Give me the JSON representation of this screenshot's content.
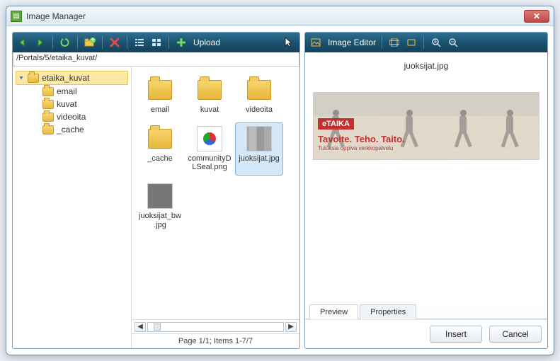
{
  "window": {
    "title": "Image Manager"
  },
  "toolbar": {
    "upload_label": "Upload",
    "editor_label": "Image Editor"
  },
  "path": "/Portals/5/etaika_kuvat/",
  "tree": {
    "root": {
      "label": "etaika_kuvat"
    },
    "children": [
      {
        "label": "email"
      },
      {
        "label": "kuvat"
      },
      {
        "label": "videoita"
      },
      {
        "label": "_cache"
      }
    ]
  },
  "grid": {
    "items": [
      {
        "label": "email",
        "type": "folder"
      },
      {
        "label": "kuvat",
        "type": "folder"
      },
      {
        "label": "videoita",
        "type": "folder"
      },
      {
        "label": "_cache",
        "type": "folder"
      },
      {
        "label": "communityDLSeal.png",
        "type": "image-doc"
      },
      {
        "label": "juoksijat.jpg",
        "type": "image",
        "selected": true
      },
      {
        "label": "juoksijat_bw.jpg",
        "type": "image-bw"
      }
    ]
  },
  "footer": {
    "status": "Page 1/1; Items 1-7/7"
  },
  "preview": {
    "filename": "juoksijat.jpg",
    "brand": "eTAIKA",
    "tagline": "Tavoite. Teho. Taito.",
    "subtag": "Tuloksia oppiva verkkopalvelu"
  },
  "tabs": {
    "preview": "Preview",
    "properties": "Properties"
  },
  "buttons": {
    "insert": "Insert",
    "cancel": "Cancel"
  }
}
